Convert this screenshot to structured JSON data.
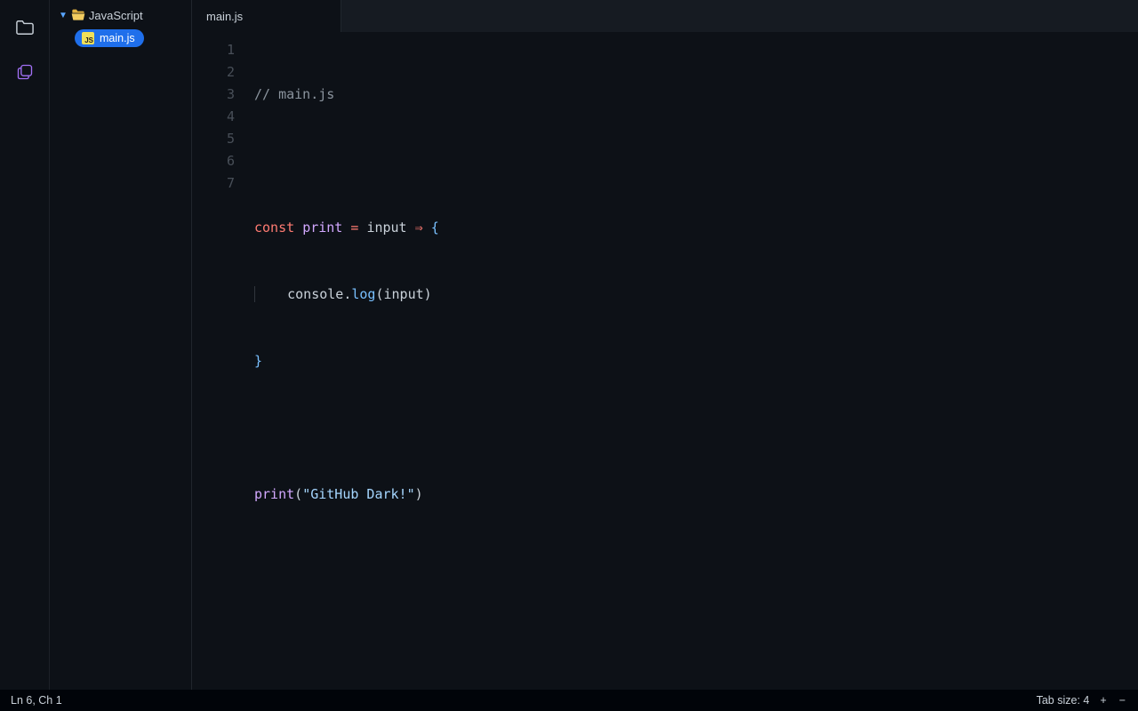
{
  "sidebar": {
    "folder_name": "JavaScript",
    "file_name": "main.js"
  },
  "tabs": {
    "active": "main.js"
  },
  "editor": {
    "line_numbers": [
      "1",
      "2",
      "3",
      "4",
      "5",
      "6",
      "7"
    ],
    "tokens": {
      "l1_comment": "// main.js",
      "l3_const": "const",
      "l3_print": "print",
      "l3_eq": "=",
      "l3_input": "input",
      "l3_arrow": "⇒",
      "l3_lbrace": "{",
      "l4_indent": "    ",
      "l4_console": "console",
      "l4_dot": ".",
      "l4_log": "log",
      "l4_lparen": "(",
      "l4_arg": "input",
      "l4_rparen": ")",
      "l5_rbrace": "}",
      "l7_print": "print",
      "l7_lparen": "(",
      "l7_str": "\"GitHub Dark!\"",
      "l7_rparen": ")"
    }
  },
  "status": {
    "position": "Ln 6, Ch 1",
    "tab_size_label": "Tab size: 4",
    "plus": "+",
    "minus": "−"
  }
}
